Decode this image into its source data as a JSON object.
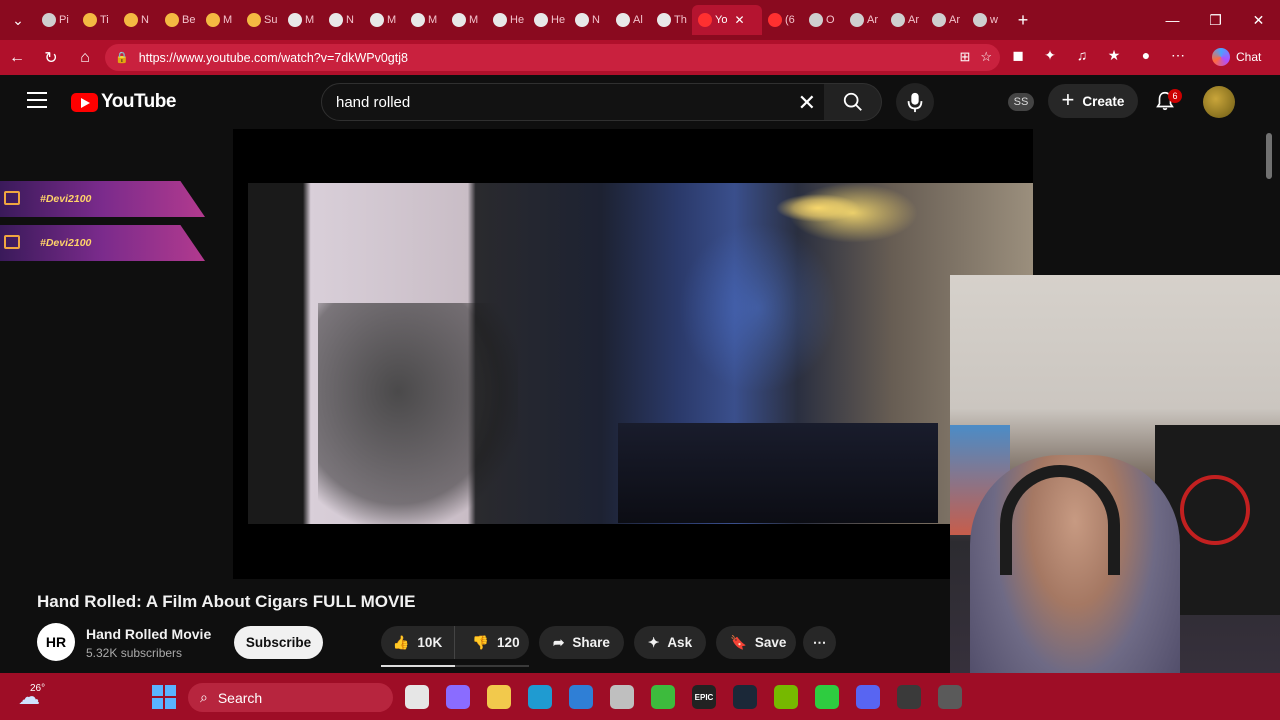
{
  "browser": {
    "tabs": [
      {
        "label": "Pi",
        "icon": "game-icon"
      },
      {
        "label": "Ti",
        "icon": "check-icon"
      },
      {
        "label": "N",
        "icon": "check-icon"
      },
      {
        "label": "Be",
        "icon": "check-icon"
      },
      {
        "label": "M",
        "icon": "check-icon"
      },
      {
        "label": "Su",
        "icon": "check-icon"
      },
      {
        "label": "M",
        "icon": "openai-icon"
      },
      {
        "label": "N",
        "icon": "openai-icon"
      },
      {
        "label": "M",
        "icon": "openai-icon"
      },
      {
        "label": "M",
        "icon": "openai-icon"
      },
      {
        "label": "M",
        "icon": "openai-icon"
      },
      {
        "label": "He",
        "icon": "openai-icon"
      },
      {
        "label": "He",
        "icon": "openai-icon"
      },
      {
        "label": "N",
        "icon": "openai-icon"
      },
      {
        "label": "Al",
        "icon": "openai-icon"
      },
      {
        "label": "Th",
        "icon": "openai-icon"
      },
      {
        "label": "Yo",
        "icon": "youtube-icon",
        "active": true
      },
      {
        "label": "(6",
        "icon": "youtube-icon"
      },
      {
        "label": "O",
        "icon": "dot-icon"
      },
      {
        "label": "Ar",
        "icon": "page-icon"
      },
      {
        "label": "Ar",
        "icon": "page-icon"
      },
      {
        "label": "Ar",
        "icon": "page-icon"
      },
      {
        "label": "w",
        "icon": "chrome-icon"
      }
    ],
    "url": "https://www.youtube.com/watch?v=7dkWPv0gtj8",
    "chat_label": "Chat"
  },
  "youtube": {
    "logo_text": "YouTube",
    "search_value": "hand rolled",
    "ss_badge": "SS",
    "create_label": "Create",
    "notification_count": "6"
  },
  "overlays": {
    "tags": [
      "#Devi2100",
      "#Devi2100"
    ]
  },
  "video": {
    "title": "Hand Rolled: A Film About Cigars FULL MOVIE",
    "channel_initials": "HR",
    "channel_name": "Hand Rolled Movie",
    "subscribers": "5.32K subscribers",
    "subscribe_label": "Subscribe",
    "likes": "10K",
    "dislikes": "120",
    "like_ratio": 0.5,
    "share_label": "Share",
    "ask_label": "Ask",
    "save_label": "Save"
  },
  "taskbar": {
    "temperature": "26°",
    "search_label": "Search",
    "apps": [
      "file-explorer-icon",
      "copilot-icon",
      "folder-icon",
      "edge-icon",
      "outlook-icon",
      "settings-icon",
      "xbox-icon",
      "epic-games-icon",
      "steam-icon",
      "nvidia-icon",
      "gamepass-icon",
      "discord-icon",
      "obs-icon",
      "speedometer-icon"
    ],
    "epic_label": "EPIC"
  },
  "colors": {
    "browser_frame": "#8a0a1f",
    "youtube_red": "#ff0000",
    "page_bg": "#0f0f0f"
  }
}
